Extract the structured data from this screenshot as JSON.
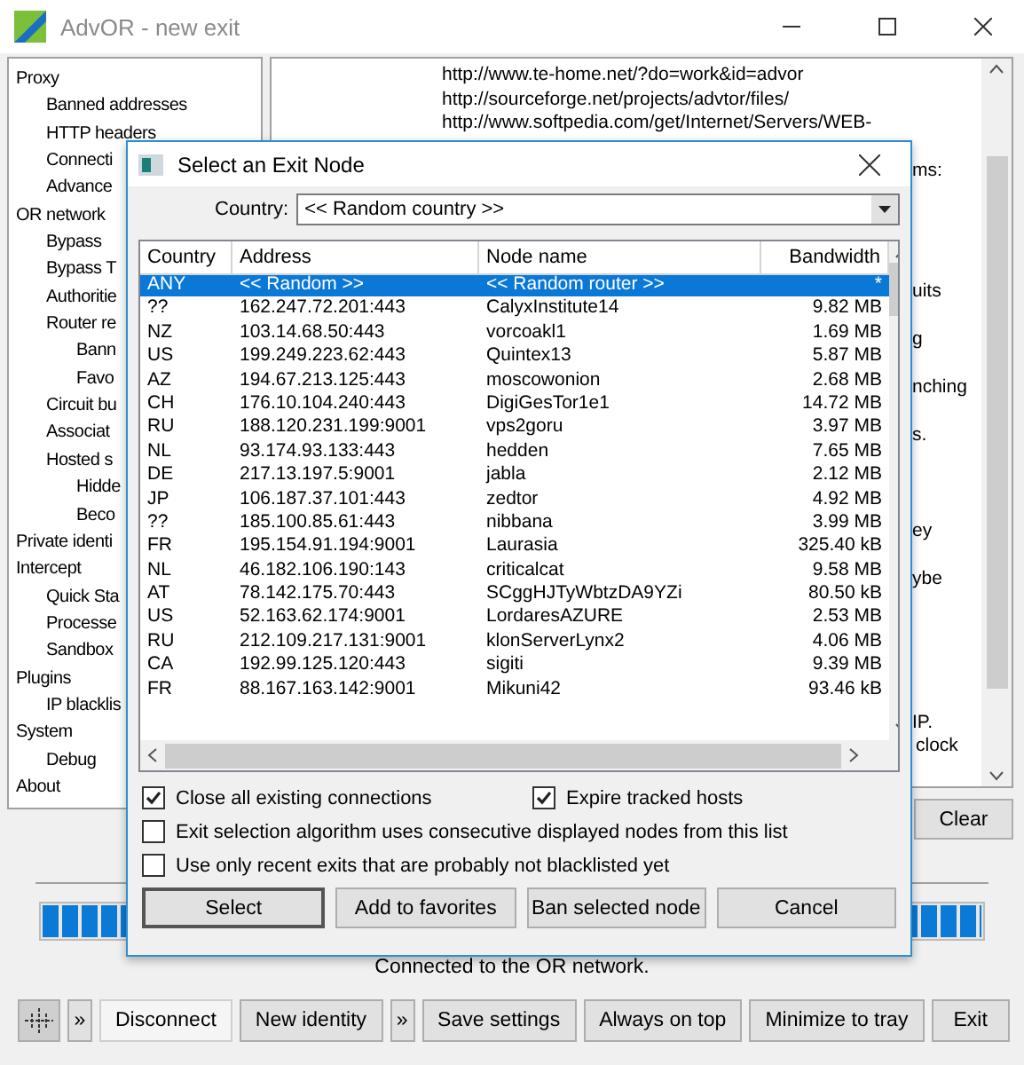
{
  "window": {
    "title": "AdvOR - new exit"
  },
  "sidebar": {
    "items": [
      {
        "label": "Proxy",
        "children": [
          {
            "label": "Banned addresses"
          },
          {
            "label": "HTTP headers"
          },
          {
            "label": "Connecti"
          },
          {
            "label": "Advance"
          }
        ]
      },
      {
        "label": "OR network",
        "children": [
          {
            "label": "Bypass"
          },
          {
            "label": "Bypass T"
          },
          {
            "label": "Authoritie"
          },
          {
            "label": "Router re",
            "children": [
              {
                "label": "Bann"
              },
              {
                "label": "Favo"
              }
            ]
          },
          {
            "label": "Circuit bu"
          },
          {
            "label": "Associat"
          },
          {
            "label": "Hosted s",
            "children": [
              {
                "label": "Hidde"
              },
              {
                "label": "Beco"
              }
            ]
          }
        ]
      },
      {
        "label": "Private identi"
      },
      {
        "label": "Intercept",
        "children": [
          {
            "label": "Quick Sta"
          },
          {
            "label": "Processe"
          },
          {
            "label": "Sandbox"
          }
        ]
      },
      {
        "label": "Plugins",
        "children": [
          {
            "label": "IP blacklis"
          }
        ]
      },
      {
        "label": "System",
        "children": [
          {
            "label": "Debug"
          }
        ]
      },
      {
        "label": "About"
      }
    ]
  },
  "log": {
    "lines": [
      "http://www.te-home.net/?do=work&id=advor",
      "http://sourceforge.net/projects/advtor/files/",
      "http://www.softpedia.com/get/Internet/Servers/WEB-"
    ],
    "fragments": [
      "ms:",
      "uits",
      "g",
      "nching",
      "s.",
      "ey",
      "ybe",
      "IP.",
      "clock"
    ]
  },
  "clear_button": "Clear",
  "progress": {
    "level": 1
  },
  "status": "Connected to the OR network.",
  "toolbar": [
    {
      "kind": "icon",
      "pressed": false
    },
    {
      "kind": "more",
      "label": "»",
      "pressed": false
    },
    {
      "kind": "button",
      "label": "Disconnect",
      "pressed": true
    },
    {
      "kind": "button",
      "label": "New identity",
      "pressed": false
    },
    {
      "kind": "more",
      "label": "»",
      "pressed": false
    },
    {
      "kind": "button",
      "label": "Save settings",
      "pressed": false
    },
    {
      "kind": "button",
      "label": "Always on top",
      "pressed": false
    },
    {
      "kind": "button",
      "label": "Minimize to tray",
      "pressed": false
    },
    {
      "kind": "button",
      "label": "Exit",
      "pressed": false
    }
  ],
  "dialog": {
    "title": "Select an Exit Node",
    "country_label": "Country:",
    "country_value": "<< Random country >>",
    "table": {
      "columns": [
        "Country",
        "Address",
        "Node name",
        "Bandwidth"
      ],
      "rows": [
        {
          "cells": [
            "ANY",
            "<< Random >>",
            "<< Random router >>",
            "*"
          ],
          "selected": true
        },
        {
          "cells": [
            "??",
            "162.247.72.201:443",
            "CalyxInstitute14",
            "9.82 MB"
          ],
          "selected": false
        },
        {
          "cells": [
            "NZ",
            "103.14.68.50:443",
            "vorcoakl1",
            "1.69 MB"
          ],
          "selected": false
        },
        {
          "cells": [
            "US",
            "199.249.223.62:443",
            "Quintex13",
            "5.87 MB"
          ],
          "selected": false
        },
        {
          "cells": [
            "AZ",
            "194.67.213.125:443",
            "moscowonion",
            "2.68 MB"
          ],
          "selected": false
        },
        {
          "cells": [
            "CH",
            "176.10.104.240:443",
            "DigiGesTor1e1",
            "14.72 MB"
          ],
          "selected": false
        },
        {
          "cells": [
            "RU",
            "188.120.231.199:9001",
            "vps2goru",
            "3.97 MB"
          ],
          "selected": false
        },
        {
          "cells": [
            "NL",
            "93.174.93.133:443",
            "hedden",
            "7.65 MB"
          ],
          "selected": false
        },
        {
          "cells": [
            "DE",
            "217.13.197.5:9001",
            "jabla",
            "2.12 MB"
          ],
          "selected": false
        },
        {
          "cells": [
            "JP",
            "106.187.37.101:443",
            "zedtor",
            "4.92 MB"
          ],
          "selected": false
        },
        {
          "cells": [
            "??",
            "185.100.85.61:443",
            "nibbana",
            "3.99 MB"
          ],
          "selected": false
        },
        {
          "cells": [
            "FR",
            "195.154.91.194:9001",
            "Laurasia",
            "325.40 kB"
          ],
          "selected": false
        },
        {
          "cells": [
            "NL",
            "46.182.106.190:143",
            "criticalcat",
            "9.58 MB"
          ],
          "selected": false
        },
        {
          "cells": [
            "AT",
            "78.142.175.70:443",
            "SCggHJTyWbtzDA9YZi",
            "80.50 kB"
          ],
          "selected": false
        },
        {
          "cells": [
            "US",
            "52.163.62.174:9001",
            "LordaresAZURE",
            "2.53 MB"
          ],
          "selected": false
        },
        {
          "cells": [
            "RU",
            "212.109.217.131:9001",
            "klonServerLynx2",
            "4.06 MB"
          ],
          "selected": false
        },
        {
          "cells": [
            "CA",
            "192.99.125.120:443",
            "sigiti",
            "9.39 MB"
          ],
          "selected": false
        },
        {
          "cells": [
            "FR",
            "88.167.163.142:9001",
            "Mikuni42",
            "93.46 kB"
          ],
          "selected": false
        }
      ]
    },
    "options": [
      {
        "label": "Close all existing connections",
        "checked": true
      },
      {
        "label": "Expire tracked hosts",
        "checked": true
      },
      {
        "label": "Exit selection algorithm uses consecutive displayed nodes from this list",
        "checked": false
      },
      {
        "label": "Use only recent exits that are probably not blacklisted yet",
        "checked": false
      }
    ],
    "buttons": [
      {
        "label": "Select",
        "default": true
      },
      {
        "label": "Add to favorites",
        "default": false
      },
      {
        "label": "Ban selected node",
        "default": false
      },
      {
        "label": "Cancel",
        "default": false
      }
    ]
  }
}
